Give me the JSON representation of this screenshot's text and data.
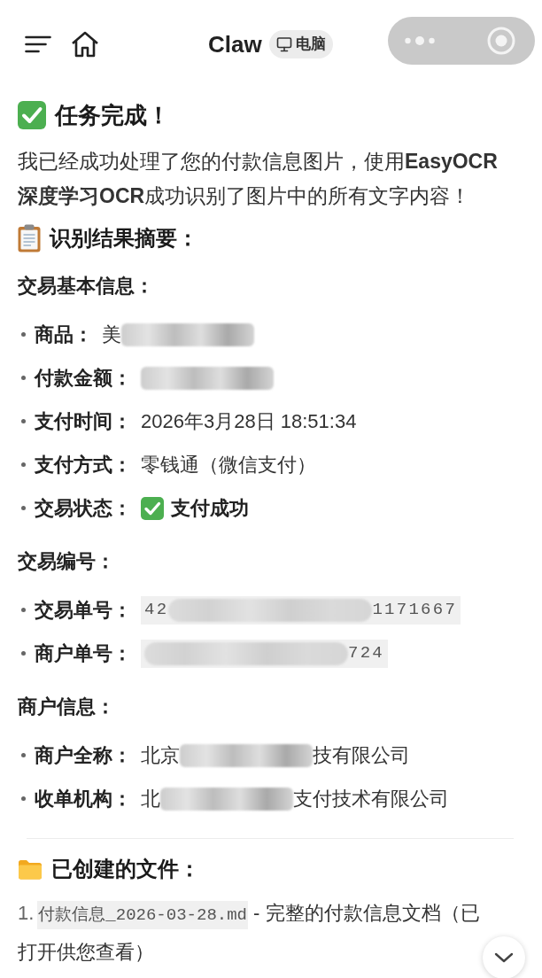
{
  "header": {
    "title": "Claw",
    "badge": "电脑"
  },
  "message": {
    "heading": "任务完成！",
    "intro": "我已经成功处理了您的付款信息图片，使用**EasyOCR深度学习OCR**成功识别了图片中的所有文字内容！",
    "summary_heading": "识别结果摘要：",
    "groups": [
      {
        "title": "交易基本信息：",
        "items": [
          {
            "label": "商品：",
            "kind": "text",
            "parts": [
              {
                "kind": "text",
                "text": "美"
              },
              {
                "kind": "blur"
              }
            ]
          },
          {
            "label": "付款金额：",
            "kind": "text",
            "parts": [
              {
                "kind": "blur"
              }
            ]
          },
          {
            "label": "支付时间：",
            "kind": "text",
            "parts": [
              {
                "kind": "text",
                "text": "2026年3月28日 18:51:34"
              }
            ]
          },
          {
            "label": "支付方式：",
            "kind": "text",
            "parts": [
              {
                "kind": "text",
                "text": "零钱通（微信支付）"
              }
            ]
          },
          {
            "label": "交易状态：",
            "kind": "status",
            "parts": [
              {
                "kind": "text",
                "text": "支付成功"
              }
            ]
          }
        ]
      },
      {
        "title": "交易编号：",
        "items": [
          {
            "label": "交易单号：",
            "kind": "code",
            "parts": [
              {
                "kind": "text",
                "text": "42"
              },
              {
                "kind": "blur"
              },
              {
                "kind": "text",
                "text": "1171667"
              }
            ]
          },
          {
            "label": "商户单号：",
            "kind": "code",
            "parts": [
              {
                "kind": "blur"
              },
              {
                "kind": "text",
                "text": "724"
              }
            ]
          }
        ]
      },
      {
        "title": "商户信息：",
        "items": [
          {
            "label": "商户全称：",
            "kind": "text",
            "parts": [
              {
                "kind": "text",
                "text": "北京"
              },
              {
                "kind": "blur"
              },
              {
                "kind": "text",
                "text": "技有限公司"
              }
            ]
          },
          {
            "label": "收单机构：",
            "kind": "text",
            "parts": [
              {
                "kind": "text",
                "text": "北"
              },
              {
                "kind": "blur"
              },
              {
                "kind": "text",
                "text": "支付技术有限公司"
              }
            ]
          }
        ]
      }
    ],
    "files_heading": "已创建的文件：",
    "files": [
      {
        "number": "1.",
        "file_name": "付款信息_2026-03-28.md",
        "description": "- 完整的付款信息文档（已打开供您查看）"
      }
    ]
  }
}
